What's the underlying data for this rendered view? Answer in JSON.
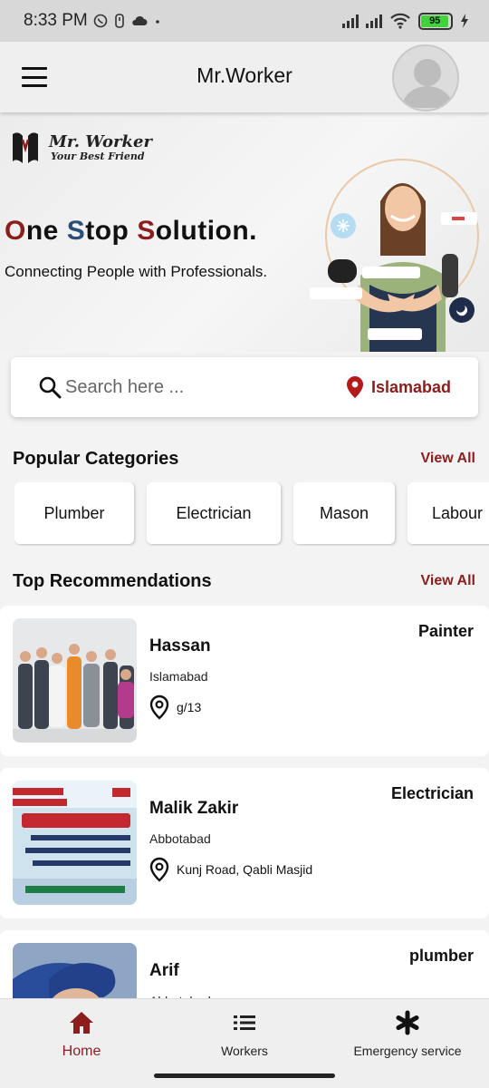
{
  "status_bar": {
    "time": "8:33 PM",
    "battery": "95"
  },
  "app_bar": {
    "title": "Mr.Worker"
  },
  "banner": {
    "brand_name": "Mr. Worker",
    "brand_tagline": "Your Best Friend",
    "headline_parts": [
      "O",
      "ne ",
      "S",
      "top ",
      "S",
      "olution."
    ],
    "subline": "Connecting People with Professionals."
  },
  "search": {
    "placeholder": "Search here ...",
    "location": "Islamabad"
  },
  "categories": {
    "title": "Popular Categories",
    "view_all": "View All",
    "items": [
      "Plumber",
      "Electrician",
      "Mason",
      "Labour"
    ]
  },
  "recommendations": {
    "title": "Top Recommendations",
    "view_all": "View All",
    "items": [
      {
        "name": "Hassan",
        "city": "Islamabad",
        "address": "g/13",
        "category": "Painter"
      },
      {
        "name": "Malik Zakir",
        "city": "Abbotabad",
        "address": "Kunj Road, Qabli Masjid",
        "category": "Electrician"
      },
      {
        "name": "Arif",
        "city": "Abbotabad",
        "address": "",
        "category": "plumber"
      }
    ]
  },
  "bottom_nav": {
    "items": [
      {
        "label": "Home",
        "icon": "home-icon"
      },
      {
        "label": "Workers",
        "icon": "list-icon"
      },
      {
        "label": "Emergency service",
        "icon": "asterisk-icon"
      }
    ]
  },
  "colors": {
    "accent": "#8c1d1d",
    "blue": "#2c4f77",
    "background": "#f3f3f3"
  }
}
